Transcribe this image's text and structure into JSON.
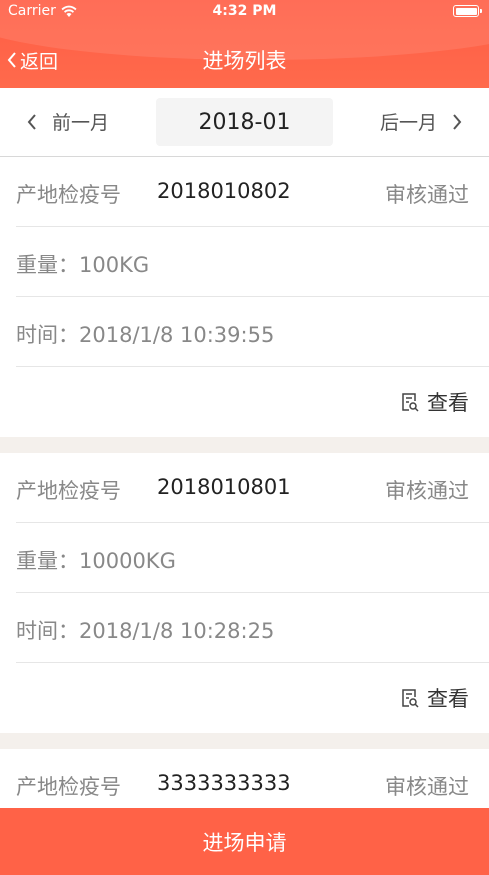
{
  "status_bar": {
    "carrier": "Carrier",
    "time": "4:32 PM"
  },
  "nav": {
    "back_label": "返回",
    "title": "进场列表"
  },
  "month_selector": {
    "prev_label": "前一月",
    "current": "2018-01",
    "next_label": "后一月"
  },
  "records": [
    {
      "code_label": "产地检疫号",
      "code": "2018010802",
      "status": "审核通过",
      "weight_label": "重量：",
      "weight": "100KG",
      "time_label": "时间：",
      "time": "2018/1/8 10:39:55",
      "view_label": "查看"
    },
    {
      "code_label": "产地检疫号",
      "code": "2018010801",
      "status": "审核通过",
      "weight_label": "重量：",
      "weight": "10000KG",
      "time_label": "时间：",
      "time": "2018/1/8 10:28:25",
      "view_label": "查看"
    },
    {
      "code_label": "产地检疫号",
      "code": "3333333333",
      "status": "审核通过"
    }
  ],
  "bottom_button": {
    "label": "进场申请"
  },
  "colors": {
    "accent": "#ff6247",
    "separator": "#f4f0ec"
  },
  "icons": {
    "wifi": "wifi-icon",
    "battery": "battery-icon",
    "back": "chevron-left-icon",
    "next": "chevron-right-icon",
    "view": "document-search-icon"
  }
}
